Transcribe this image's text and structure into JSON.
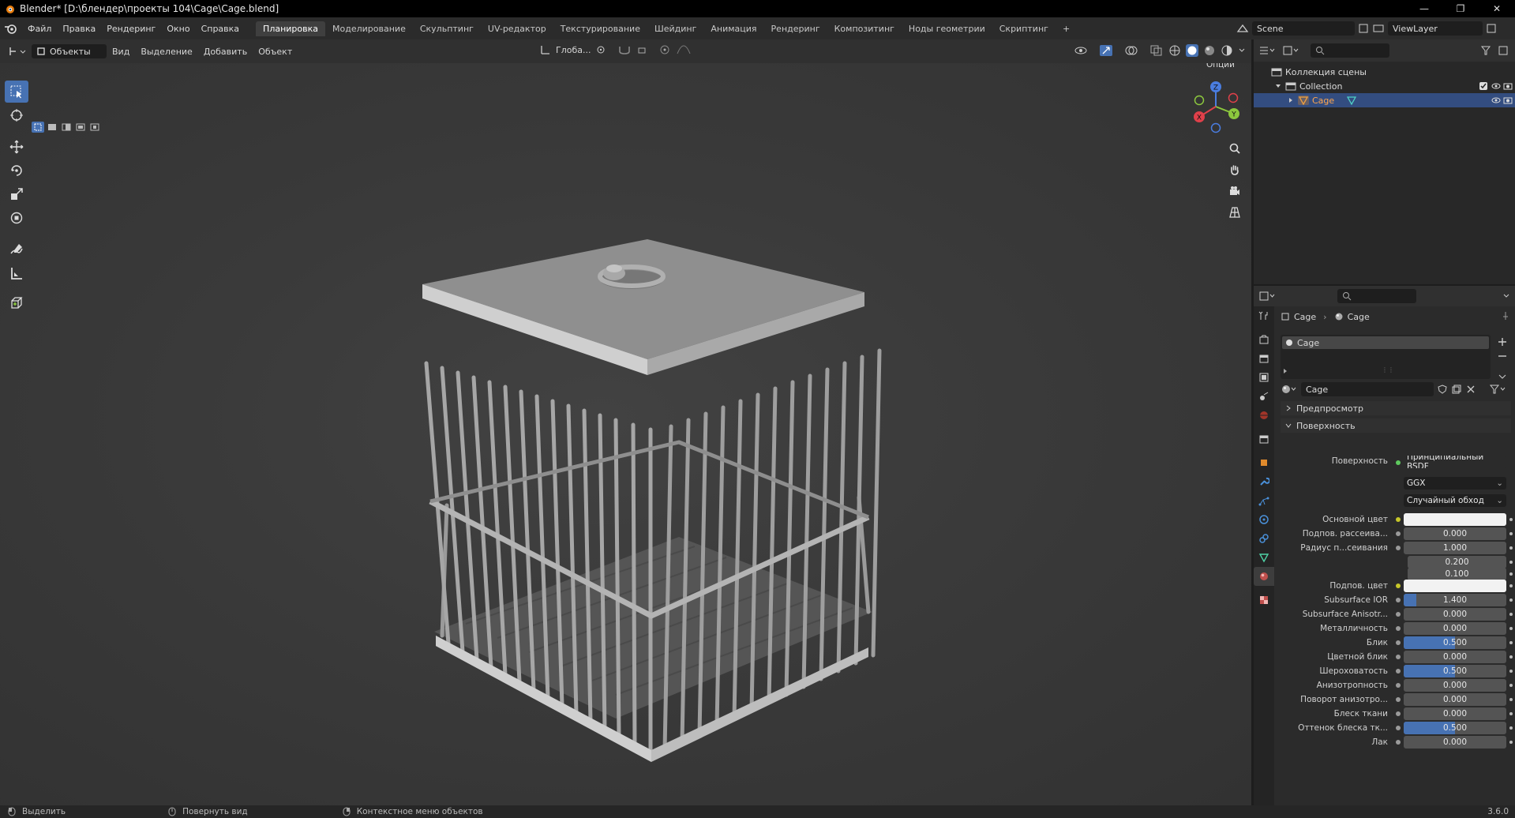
{
  "window": {
    "title": "Blender* [D:\\блендер\\проекты 104\\Cage\\Cage.blend]",
    "controls": [
      "—",
      "❐",
      "✕"
    ]
  },
  "menu": {
    "items": [
      "Файл",
      "Правка",
      "Рендеринг",
      "Окно",
      "Справка"
    ],
    "workspaces": [
      "Планировка",
      "Моделирование",
      "Скульптинг",
      "UV-редактор",
      "Текстурирование",
      "Шейдинг",
      "Анимация",
      "Рендеринг",
      "Композитинг",
      "Ноды геометрии",
      "Скриптинг"
    ],
    "active_workspace": "Планировка",
    "add_workspace": "+",
    "scene": "Scene",
    "view_layer": "ViewLayer"
  },
  "viewport_header": {
    "mode": "Объекты",
    "menus": [
      "Вид",
      "Выделение",
      "Добавить",
      "Объект"
    ],
    "orientation": "Глоба...",
    "options": "Опции"
  },
  "gizmo": {
    "x": "X",
    "y": "Y",
    "z": "Z"
  },
  "outliner": {
    "rows": [
      {
        "label": "Коллекция сцены",
        "level": 0
      },
      {
        "label": "Collection",
        "level": 1
      },
      {
        "label": "Cage",
        "level": 2,
        "selected": true
      }
    ]
  },
  "properties": {
    "breadcrumb": [
      "Cage",
      "Cage"
    ],
    "material_slot": "Cage",
    "material_name": "Cage",
    "sections": {
      "preview": "Предпросмотр",
      "surface": "Поверхность"
    },
    "surface_label": "Поверхность",
    "surface_value": "Принципиальный BSDF",
    "distribution": "GGX",
    "subsurface_method": "Случайный обход",
    "params": [
      {
        "label": "Основной цвет",
        "type": "color",
        "value": "",
        "color": "#f2f2f2"
      },
      {
        "label": "Подпов. рассеива...",
        "type": "num",
        "value": "0.000",
        "fill": 0
      },
      {
        "label": "Радиус п...сеивания",
        "type": "num",
        "value": "1.000",
        "fill": 0
      },
      {
        "label": "",
        "type": "num",
        "value": "0.200",
        "fill": 0
      },
      {
        "label": "",
        "type": "num",
        "value": "0.100",
        "fill": 0
      },
      {
        "label": "Подпов. цвет",
        "type": "color",
        "value": "",
        "color": "#f2f2f2"
      },
      {
        "label": "Subsurface IOR",
        "type": "num",
        "value": "1.400",
        "fill": 0.12
      },
      {
        "label": "Subsurface Anisotr...",
        "type": "num",
        "value": "0.000",
        "fill": 0
      },
      {
        "label": "Металличность",
        "type": "num",
        "value": "0.000",
        "fill": 0
      },
      {
        "label": "Блик",
        "type": "num",
        "value": "0.500",
        "fill": 0.5
      },
      {
        "label": "Цветной блик",
        "type": "num",
        "value": "0.000",
        "fill": 0
      },
      {
        "label": "Шероховатость",
        "type": "num",
        "value": "0.500",
        "fill": 0.5
      },
      {
        "label": "Анизотропность",
        "type": "num",
        "value": "0.000",
        "fill": 0
      },
      {
        "label": "Поворот анизотро...",
        "type": "num",
        "value": "0.000",
        "fill": 0
      },
      {
        "label": "Блеск ткани",
        "type": "num",
        "value": "0.000",
        "fill": 0
      },
      {
        "label": "Оттенок блеска тк...",
        "type": "num",
        "value": "0.500",
        "fill": 0.5
      },
      {
        "label": "Лак",
        "type": "num",
        "value": "0.000",
        "fill": 0
      }
    ]
  },
  "status": {
    "items": [
      "Выделить",
      "Повернуть вид",
      "Контекстное меню объектов"
    ],
    "version": "3.6.0"
  },
  "colors": {
    "accent": "#4772b3",
    "selection": "#334d80",
    "panel": "#2b2b2b"
  }
}
